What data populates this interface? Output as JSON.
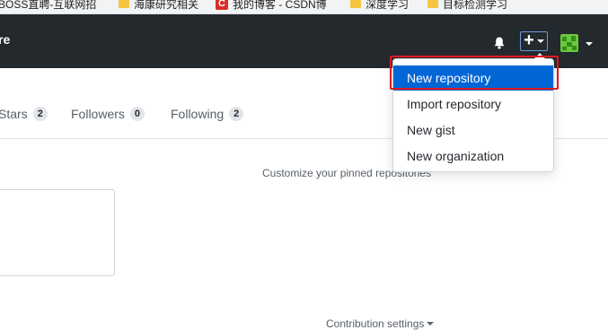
{
  "bookmarks": [
    {
      "label": "BOSS直聘-互联网招",
      "icon": "folder-icon"
    },
    {
      "label": "海康研究相关",
      "icon": "folder-icon"
    },
    {
      "label": "我的博客 - CSDN博",
      "icon": "csdn-icon",
      "icon_text": "C"
    },
    {
      "label": "深度学习",
      "icon": "folder-icon"
    },
    {
      "label": "目标检测学习",
      "icon": "folder-icon"
    }
  ],
  "header": {
    "brand_text": "re",
    "background": "#24292e"
  },
  "profile_nav": {
    "stars_label": "Stars",
    "stars_count": "2",
    "followers_label": "Followers",
    "followers_count": "0",
    "following_label": "Following",
    "following_count": "2"
  },
  "main": {
    "customize_text": "Customize your pinned repositories",
    "contribution_settings": "Contribution settings"
  },
  "new_menu": {
    "items": [
      {
        "label": "New repository",
        "selected": true
      },
      {
        "label": "Import repository",
        "selected": false
      },
      {
        "label": "New gist",
        "selected": false
      },
      {
        "label": "New organization",
        "selected": false
      }
    ],
    "highlight_color": "#e0191b",
    "selected_color": "#0366d6"
  }
}
